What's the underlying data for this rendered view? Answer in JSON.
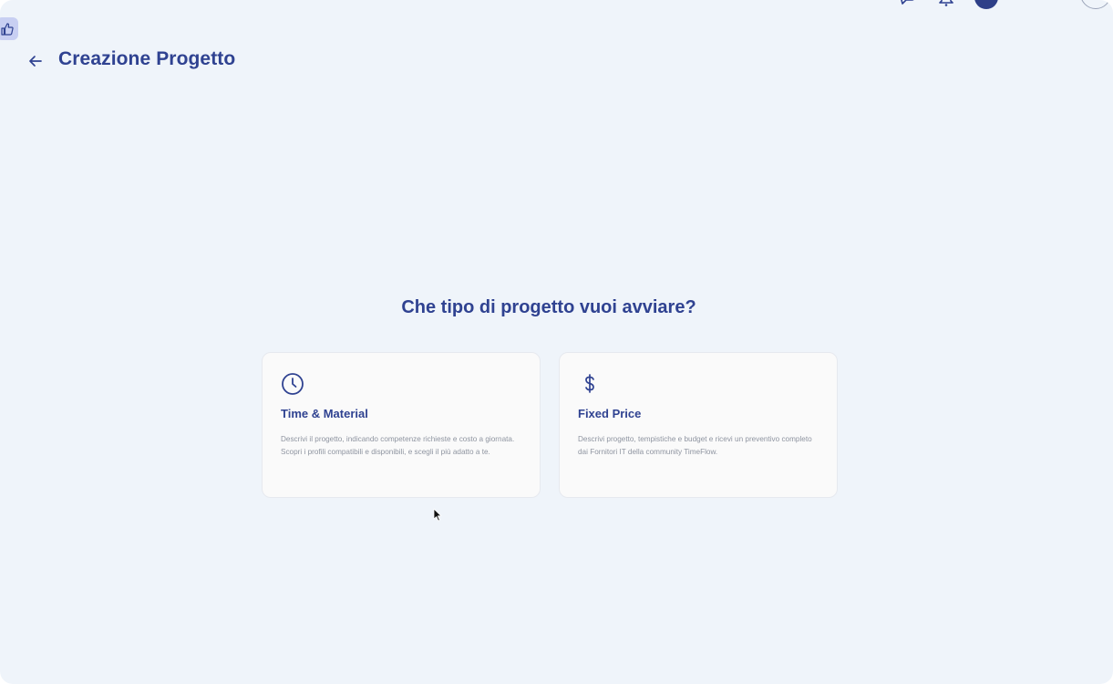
{
  "header": {
    "title": "Creazione Progetto"
  },
  "main": {
    "question": "Che tipo di progetto vuoi avviare?",
    "cards": [
      {
        "title": "Time & Material",
        "description": "Descrivi il progetto, indicando competenze richieste e costo a giornata. Scopri i profili compatibili e disponibili, e scegli il più adatto a te.",
        "icon": "clock-icon"
      },
      {
        "title": "Fixed Price",
        "description": "Descrivi progetto, tempistiche e budget e ricevi un preventivo completo dai Fornitori IT della community TimeFlow.",
        "icon": "dollar-icon"
      }
    ]
  },
  "colors": {
    "background": "#eff4fa",
    "primary": "#2f4291",
    "card": "#fafafa",
    "muted_text": "#8e94a0"
  }
}
